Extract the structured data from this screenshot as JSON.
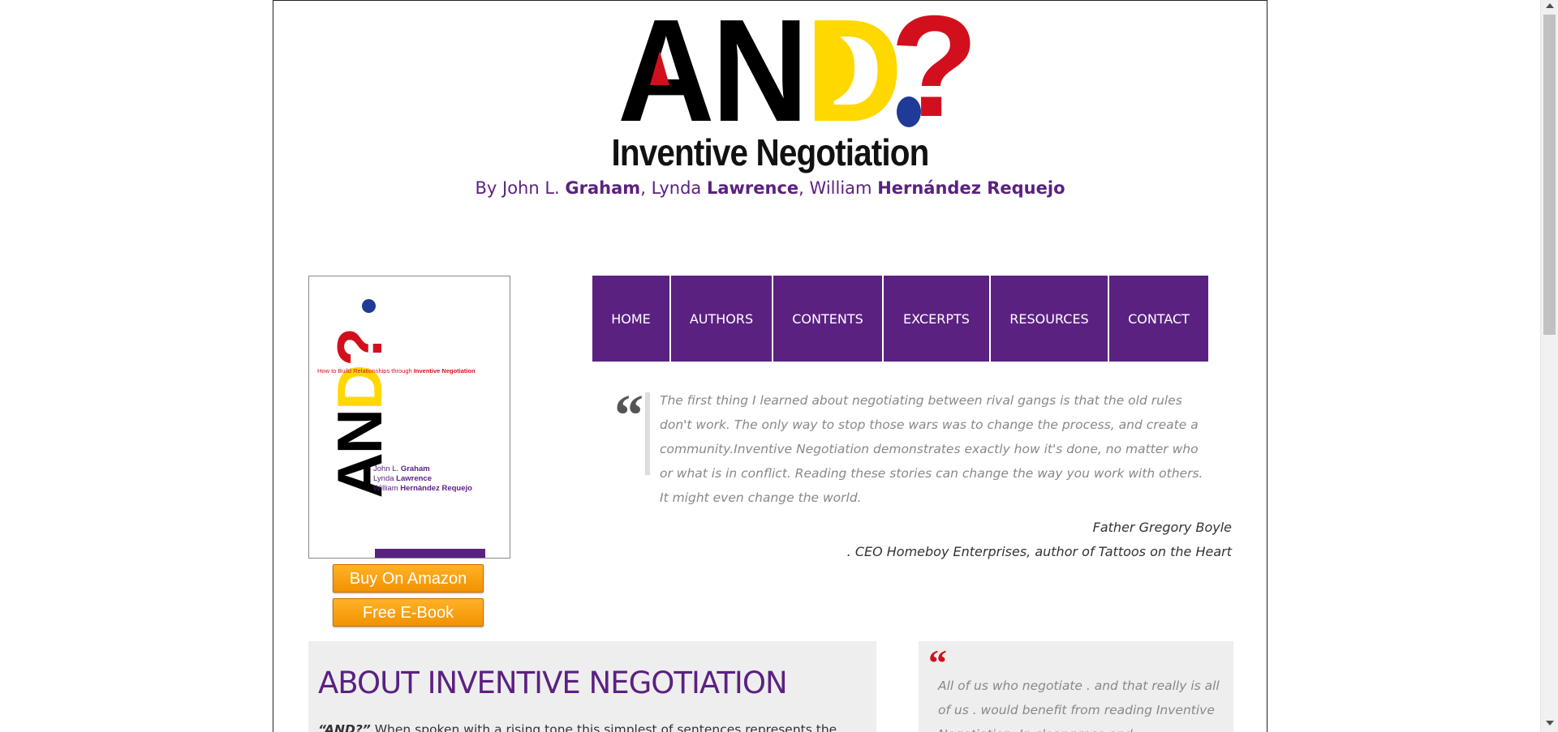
{
  "logo": {
    "word": "AND?",
    "title": "Inventive Negotiation",
    "by": "By",
    "authors": [
      {
        "first": "John L.",
        "last": "Graham"
      },
      {
        "first": "Lynda",
        "last": "Lawrence"
      },
      {
        "first": "William",
        "last": "Hernández Requejo"
      }
    ]
  },
  "cover": {
    "word": "AND?",
    "subtitle_plain": "How to Build Relationships through",
    "subtitle_bold": "Inventive Negotiation",
    "authors": [
      {
        "first": "John L.",
        "last": "Graham"
      },
      {
        "first": "Lynda",
        "last": "Lawrence"
      },
      {
        "first": "William",
        "last": "Hernández Requejo"
      }
    ]
  },
  "buttons": {
    "amazon": "Buy On Amazon",
    "ebook": "Free E-Book"
  },
  "nav": [
    "HOME",
    "AUTHORS",
    "CONTENTS",
    "EXCERPTS",
    "RESOURCES",
    "CONTACT"
  ],
  "testimonial": {
    "mark": "“",
    "text": "The first thing I learned about negotiating between rival gangs is that the old rules don't work. The only way to stop those wars was to change the process, and create a community.Inventive Negotiation demonstrates exactly how it's done, no matter who or what is in conflict. Reading these stories can change the way you work with others. It might even change the world.",
    "author": "Father Gregory Boyle",
    "role": ". CEO Homeboy Enterprises, author of Tattoos on the Heart"
  },
  "about": {
    "title": "ABOUT INVENTIVE NEGOTIATION",
    "lead": "“AND?”",
    "text": " When spoken with a rising tone this simplest of sentences represents the"
  },
  "side_quote": {
    "mark": "“",
    "text": "All of us who negotiate . and that really is all of us . would benefit from reading Inventive Negotiation. In clear prose and"
  },
  "colors": {
    "brand_purple": "#5b2181",
    "logo_red": "#d2101d",
    "logo_yellow": "#ffd800",
    "logo_blue": "#1f3a97",
    "button_orange": "#f29200"
  }
}
